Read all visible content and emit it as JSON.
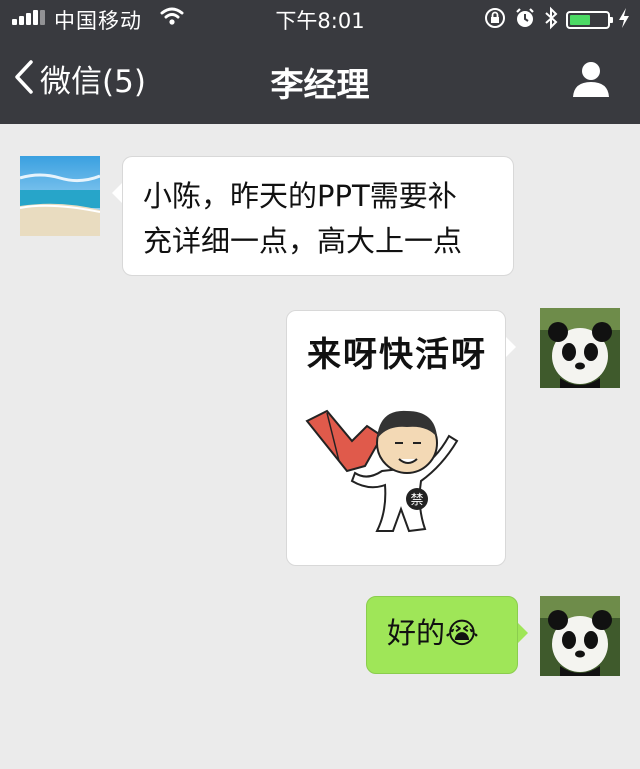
{
  "status_bar": {
    "carrier": "中国移动",
    "time": "下午8:01"
  },
  "nav": {
    "back_label": "微信(5)",
    "title": "李经理"
  },
  "messages": [
    {
      "side": "left",
      "type": "text",
      "lines": [
        "小陈，昨天的PPT需要补",
        "充详细一点，高大上一点"
      ]
    },
    {
      "side": "right",
      "type": "sticker",
      "caption": "来呀快活呀",
      "badge": "禁"
    },
    {
      "side": "right",
      "type": "text",
      "text": "好的",
      "emoji": "😭"
    }
  ],
  "colors": {
    "header": "#393a3f",
    "chat_background": "#ebebeb",
    "self_bubble": "#9fe658",
    "other_bubble": "#ffffff",
    "battery": "#4cd964"
  },
  "icons": [
    "wifi-icon",
    "orientation-lock-icon",
    "alarm-icon",
    "bluetooth-icon",
    "battery-icon",
    "charging-icon",
    "back-chevron-icon",
    "profile-icon"
  ]
}
